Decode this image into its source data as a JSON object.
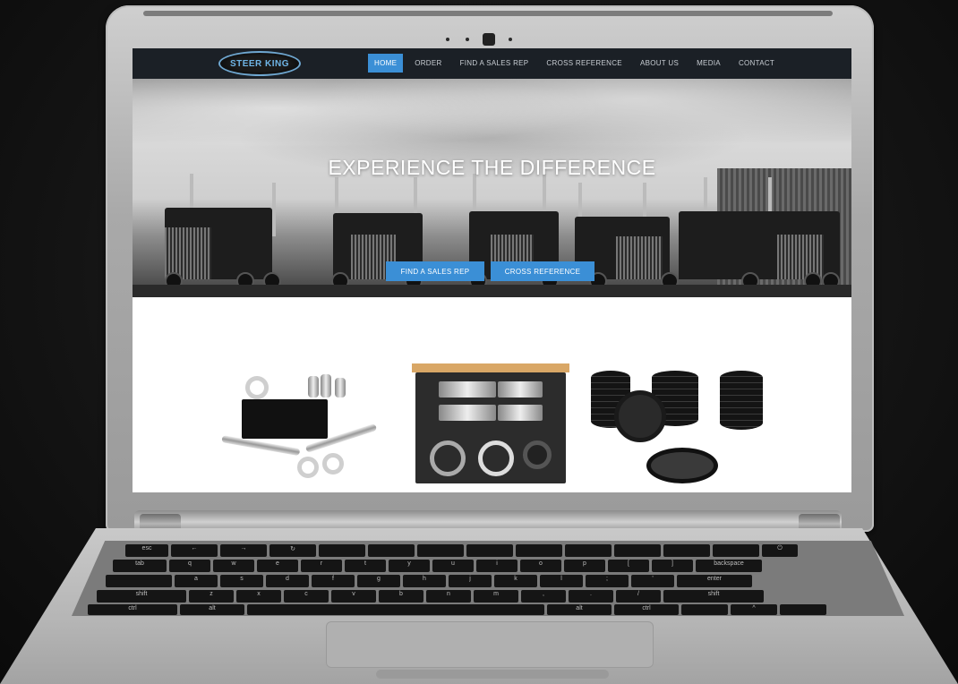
{
  "site": {
    "logo_text": "STEER KING",
    "nav": [
      {
        "label": "HOME",
        "active": true
      },
      {
        "label": "ORDER",
        "active": false
      },
      {
        "label": "FIND A SALES REP",
        "active": false
      },
      {
        "label": "CROSS REFERENCE",
        "active": false
      },
      {
        "label": "ABOUT US",
        "active": false
      },
      {
        "label": "MEDIA",
        "active": false
      },
      {
        "label": "CONTACT",
        "active": false
      }
    ],
    "hero": {
      "headline": "EXPERIENCE THE DIFFERENCE",
      "buttons": [
        "FIND A SALES REP",
        "CROSS REFERENCE"
      ]
    }
  },
  "keyboard": {
    "row1": [
      "esc",
      "←",
      "→",
      "↻",
      "",
      "",
      "",
      "",
      "",
      "",
      "",
      "",
      "",
      "⏻"
    ],
    "row2": [
      "tab",
      "q",
      "w",
      "e",
      "r",
      "t",
      "y",
      "u",
      "i",
      "o",
      "p",
      "[",
      "]",
      "backspace"
    ],
    "row3": [
      "",
      "a",
      "s",
      "d",
      "f",
      "g",
      "h",
      "j",
      "k",
      "l",
      ";",
      "'",
      "enter"
    ],
    "row4": [
      "shift",
      "z",
      "x",
      "c",
      "v",
      "b",
      "n",
      "m",
      ",",
      ".",
      "/",
      "shift"
    ],
    "row5": [
      "ctrl",
      "alt",
      "",
      "alt",
      "ctrl",
      "",
      "^",
      ""
    ]
  },
  "colors": {
    "accent": "#3b8fd6",
    "nav_bg": "#1b2026"
  }
}
